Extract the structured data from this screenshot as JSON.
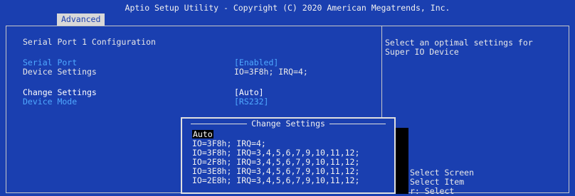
{
  "header": {
    "title": "Aptio Setup Utility - Copyright (C) 2020 American Megatrends, Inc.",
    "tab": "Advanced"
  },
  "main": {
    "section_title": "Serial Port 1 Configuration",
    "rows": [
      {
        "label": "Serial Port",
        "value": "[Enabled]"
      },
      {
        "label": "Device Settings",
        "value": "IO=3F8h; IRQ=4;"
      },
      {
        "label": "Change Settings",
        "value": "[Auto]"
      },
      {
        "label": "Device Mode",
        "value": "[RS232]"
      }
    ]
  },
  "help": {
    "line1": "Select an optimal settings for",
    "line2": "Super IO Device"
  },
  "popup": {
    "title": "Change Settings",
    "options": [
      "Auto",
      "IO=3F8h; IRQ=4;",
      "IO=3F8h; IRQ=3,4,5,6,7,9,10,11,12;",
      "IO=2F8h; IRQ=3,4,5,6,7,9,10,11,12;",
      "IO=3E8h; IRQ=3,4,5,6,7,9,10,11,12;",
      "IO=2E8h; IRQ=3,4,5,6,7,9,10,11,12;"
    ],
    "selected_index": 0
  },
  "keys": {
    "line1": "Select Screen",
    "line2": "Select Item",
    "line3": "r: Select"
  },
  "colors": {
    "background": "#1a3fb0",
    "option_label": "#4fa8ff",
    "text": "#e8e8e8"
  }
}
